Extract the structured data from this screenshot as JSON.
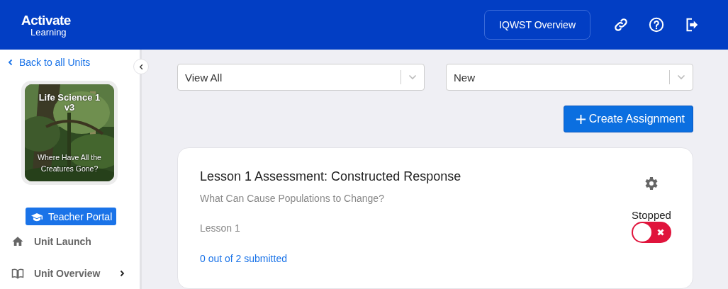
{
  "header": {
    "logo_top": "Activate",
    "logo_bottom": "Learning",
    "overview_button": "IQWST Overview"
  },
  "sidebar": {
    "back_link": "Back to all Units",
    "unit": {
      "title": "Life Science 1 v3",
      "subtitle": "Where Have All the Creatures Gone?"
    },
    "portal_button": "Teacher Portal",
    "items": [
      {
        "label": "Unit Launch",
        "kind": "home",
        "has_submenu": false
      },
      {
        "label": "Unit Overview",
        "kind": "book",
        "has_submenu": true
      }
    ]
  },
  "filters": [
    {
      "value": "View All"
    },
    {
      "value": "New"
    }
  ],
  "create_button": "Create Assignment",
  "assignments": [
    {
      "title": "Lesson 1 Assessment: Constructed Response",
      "subtitle": "What Can Cause Populations to Change?",
      "lesson": "Lesson 1",
      "submitted": "0 out of 2 submitted",
      "status": "Stopped",
      "on": false
    }
  ]
}
